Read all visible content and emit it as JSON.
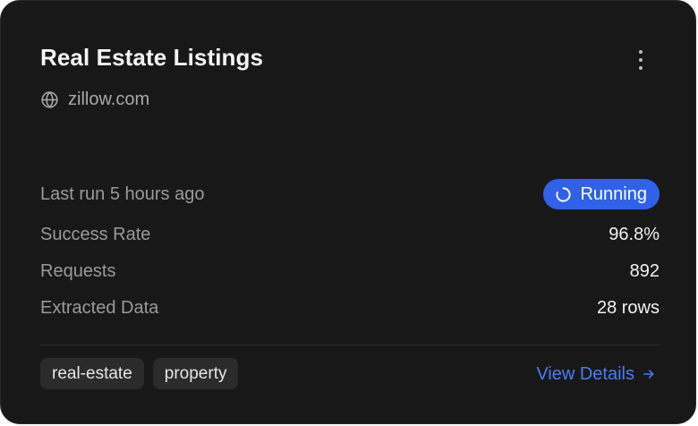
{
  "card": {
    "title": "Real Estate Listings",
    "domain": "zillow.com",
    "domain_icon": "globe-icon",
    "menu_icon": "more-vertical-icon"
  },
  "status": {
    "last_run": "Last run 5 hours ago",
    "badge": "Running",
    "badge_icon": "spinner-icon",
    "badge_color": "#2f62e8"
  },
  "stats": {
    "success_rate_label": "Success Rate",
    "success_rate_value": "96.8%",
    "requests_label": "Requests",
    "requests_value": "892",
    "extracted_label": "Extracted Data",
    "extracted_value": "28 rows"
  },
  "tags": [
    "real-estate",
    "property"
  ],
  "footer": {
    "view_details": "View Details",
    "view_details_icon": "arrow-right-icon",
    "link_color": "#4a7dfa"
  },
  "colors": {
    "card_background": "#181818",
    "card_border": "#2a2a2a"
  }
}
